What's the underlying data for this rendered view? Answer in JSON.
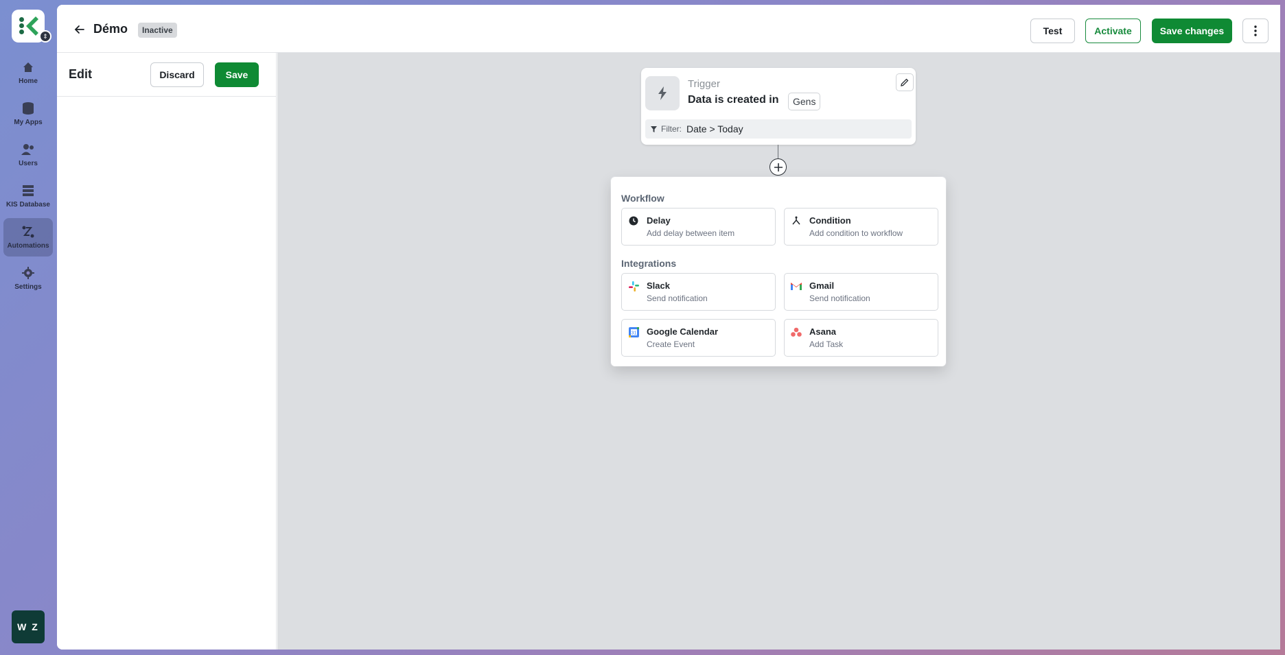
{
  "sidebar": {
    "logo_letter": "K",
    "items": [
      {
        "label": "Home",
        "icon": "home-icon"
      },
      {
        "label": "My Apps",
        "icon": "apps-icon"
      },
      {
        "label": "Users",
        "icon": "users-icon"
      },
      {
        "label": "KIS Database",
        "icon": "database-icon"
      },
      {
        "label": "Automations",
        "icon": "automations-icon",
        "active": true
      },
      {
        "label": "Settings",
        "icon": "gear-icon"
      }
    ],
    "avatar_initials": "W Z"
  },
  "header": {
    "title": "Démo",
    "status": "Inactive",
    "test_label": "Test",
    "activate_label": "Activate",
    "save_changes_label": "Save changes"
  },
  "edit_panel": {
    "title": "Edit",
    "discard_label": "Discard",
    "save_label": "Save"
  },
  "trigger": {
    "label": "Trigger",
    "text": "Data is created in",
    "table": "Gens",
    "filter_label": "Filter:",
    "filter_value": "Date > Today"
  },
  "menu": {
    "workflow_label": "Workflow",
    "integrations_label": "Integrations",
    "workflow": [
      {
        "title": "Delay",
        "desc": "Add delay between item",
        "icon": "clock-icon"
      },
      {
        "title": "Condition",
        "desc": "Add condition to workflow",
        "icon": "branch-icon"
      }
    ],
    "integrations": [
      {
        "title": "Slack",
        "desc": "Send notification",
        "icon": "slack-icon"
      },
      {
        "title": "Gmail",
        "desc": "Send notification",
        "icon": "gmail-icon"
      },
      {
        "title": "Google Calendar",
        "desc": "Create Event",
        "icon": "google-calendar-icon"
      },
      {
        "title": "Asana",
        "desc": "Add Task",
        "icon": "asana-icon"
      }
    ]
  },
  "colors": {
    "primary_green": "#0f8a34",
    "canvas_bg": "#dcdee1",
    "avatar_bg": "#0f3b36"
  }
}
